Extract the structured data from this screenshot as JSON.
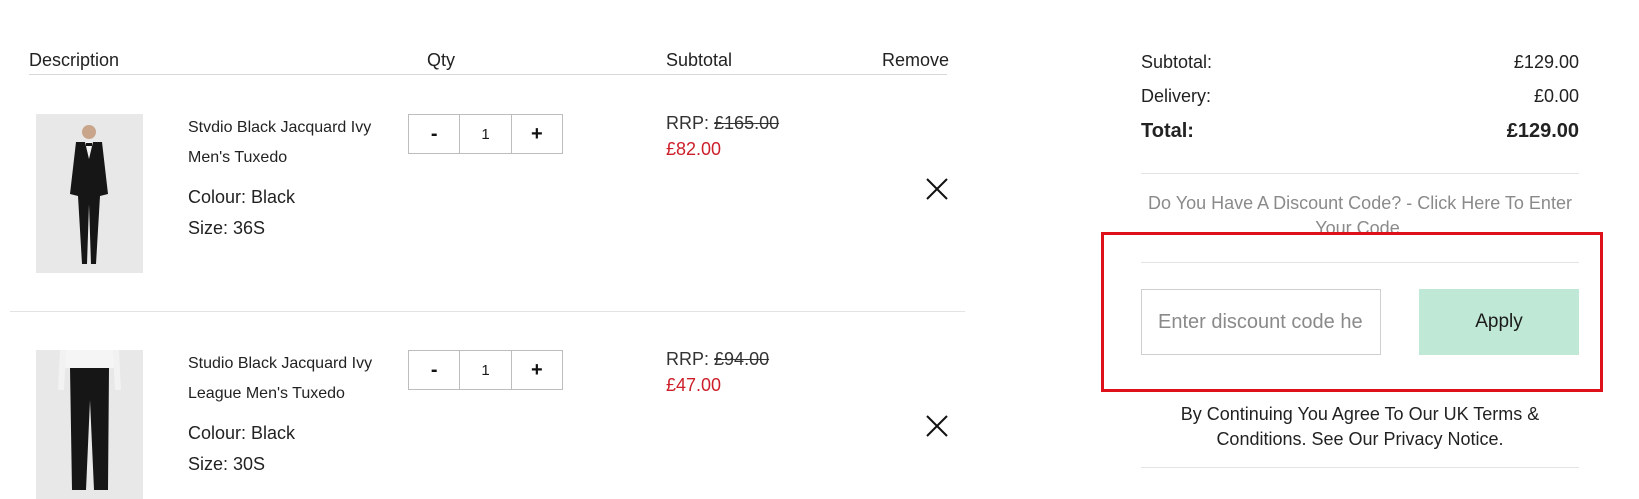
{
  "table_header": {
    "description": "Description",
    "qty": "Qty",
    "subtotal": "Subtotal",
    "remove": "Remove"
  },
  "items": [
    {
      "name_line1": "Stvdio Black Jacquard Ivy",
      "name_line2": "Men's Tuxedo",
      "colour": "Colour: Black",
      "size": "Size: 36S",
      "qty": "1",
      "minus": "-",
      "plus": "+",
      "rrp_label": "RRP:",
      "rrp_price": "£165.00",
      "sale_price": "£82.00"
    },
    {
      "name_line1": "Studio Black Jacquard Ivy",
      "name_line2": "League Men's Tuxedo",
      "colour": "Colour: Black",
      "size": "Size: 30S",
      "qty": "1",
      "minus": "-",
      "plus": "+",
      "rrp_label": "RRP:",
      "rrp_price": "£94.00",
      "sale_price": "£47.00"
    }
  ],
  "summary": {
    "subtotal_label": "Subtotal:",
    "subtotal_value": "£129.00",
    "delivery_label": "Delivery:",
    "delivery_value": "£0.00",
    "total_label": "Total:",
    "total_value": "£129.00"
  },
  "discount": {
    "link_text": "Do You Have A Discount Code? - Click Here To Enter Your Code.",
    "input_placeholder": "Enter discount code here",
    "apply_label": "Apply"
  },
  "terms_text": "By Continuing You Agree To Our UK Terms & Conditions. See Our Privacy Notice.",
  "colors": {
    "sale_red": "#cc1f2a",
    "apply_bg": "#bfe8d6",
    "highlight_border": "#e0101a"
  }
}
